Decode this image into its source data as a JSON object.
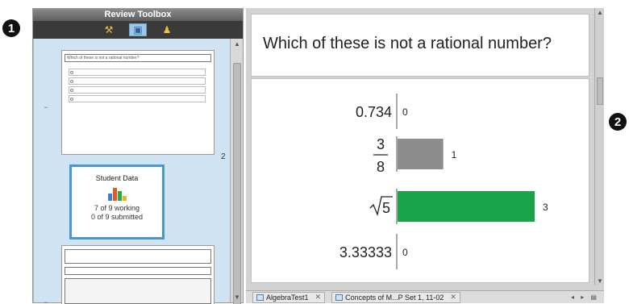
{
  "callouts": [
    "1",
    "2"
  ],
  "toolbox": {
    "title": "Review Toolbox",
    "tabs": [
      {
        "name": "tools-icon",
        "active": false
      },
      {
        "name": "review-icon",
        "active": true
      },
      {
        "name": "class-icon",
        "active": false
      }
    ],
    "page1": {
      "question": "Which of these is not a rational number?",
      "number": "2"
    },
    "student_data": {
      "title": "Student Data",
      "working": "7 of 9 working",
      "submitted": "0 of 9 submitted"
    }
  },
  "question": {
    "text": "Which of these is not a rational number?"
  },
  "chart_data": {
    "type": "bar",
    "orientation": "horizontal",
    "categories": [
      "0.734",
      "3/8",
      "√5",
      "3.33333"
    ],
    "values": [
      0,
      1,
      3,
      0
    ],
    "colors": [
      "#888888",
      "#8d8d8d",
      "#1aa34a",
      "#888888"
    ],
    "xlim": [
      0,
      3
    ]
  },
  "tabs": [
    {
      "label": "AlgebraTest1"
    },
    {
      "label": "Concepts of M...P Set 1, 11-02"
    }
  ]
}
